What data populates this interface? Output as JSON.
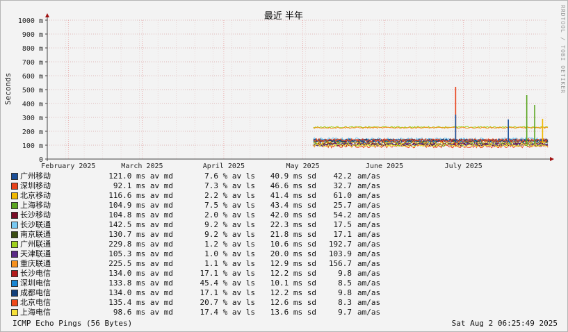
{
  "chart_data": {
    "type": "line",
    "title": "最近 半年",
    "ylabel": "Seconds",
    "ylim": [
      0,
      1000
    ],
    "y_ticks": [
      "0",
      "100 m",
      "200 m",
      "300 m",
      "400 m",
      "500 m",
      "600 m",
      "700 m",
      "800 m",
      "900 m",
      "1000 m"
    ],
    "x_ticks": [
      {
        "label": "February 2025",
        "date": "2025-02-01"
      },
      {
        "label": "March 2025",
        "date": "2025-03-01"
      },
      {
        "label": "April 2025",
        "date": "2025-04-01"
      },
      {
        "label": "May 2025",
        "date": "2025-05-01"
      },
      {
        "label": "June 2025",
        "date": "2025-06-01"
      },
      {
        "label": "July 2025",
        "date": "2025-07-01"
      }
    ],
    "x_range": [
      "2025-01-24",
      "2025-08-02"
    ],
    "grid": true,
    "data_start": "2025-05-05",
    "series": [
      {
        "name": "广州移动",
        "color": "#1a4f99",
        "avg": 121.0
      },
      {
        "name": "深圳移动",
        "color": "#e8421b",
        "avg": 92.1
      },
      {
        "name": "北京移动",
        "color": "#f0b800",
        "avg": 116.6
      },
      {
        "name": "上海移动",
        "color": "#5aa520",
        "avg": 104.9
      },
      {
        "name": "长沙移动",
        "color": "#7a0d27",
        "avg": 104.8
      },
      {
        "name": "长沙联通",
        "color": "#79c9f2",
        "avg": 142.5
      },
      {
        "name": "南京联通",
        "color": "#3a4d12",
        "avg": 130.7
      },
      {
        "name": "广州联通",
        "color": "#9ed11d",
        "avg": 229.8
      },
      {
        "name": "天津联通",
        "color": "#5a2a86",
        "avg": 105.3
      },
      {
        "name": "重庆联通",
        "color": "#f5901e",
        "avg": 225.5
      },
      {
        "name": "长沙电信",
        "color": "#b21a1a",
        "avg": 134.0
      },
      {
        "name": "深圳电信",
        "color": "#1a86d2",
        "avg": 133.8
      },
      {
        "name": "成都电信",
        "color": "#123f7a",
        "avg": 134.0
      },
      {
        "name": "北京电信",
        "color": "#f04a1a",
        "avg": 135.4
      },
      {
        "name": "上海电信",
        "color": "#f5e03a",
        "avg": 98.6
      }
    ],
    "spikes": [
      {
        "series": "深圳移动",
        "date": "2025-06-28",
        "value": 520
      },
      {
        "series": "广州移动",
        "date": "2025-06-28",
        "value": 320
      },
      {
        "series": "上海移动",
        "date": "2025-07-25",
        "value": 460
      },
      {
        "series": "上海移动",
        "date": "2025-07-28",
        "value": 390
      },
      {
        "series": "广州移动",
        "date": "2025-07-18",
        "value": 285
      },
      {
        "series": "北京移动",
        "date": "2025-07-31",
        "value": 290
      }
    ]
  },
  "watermark": "RRDTOOL / TOBI OETIKER",
  "legend": {
    "rows": [
      {
        "name": "广州移动",
        "avg": "121.0 ms av md",
        "loss": "7.6 % av ls",
        "sd": "40.9 ms sd",
        "amas": "42.2",
        "unit": "am/as"
      },
      {
        "name": "深圳移动",
        "avg": "92.1 ms av md",
        "loss": "7.3 % av ls",
        "sd": "46.6 ms sd",
        "amas": "32.7",
        "unit": "am/as"
      },
      {
        "name": "北京移动",
        "avg": "116.6 ms av md",
        "loss": "2.2 % av ls",
        "sd": "41.4 ms sd",
        "amas": "61.0",
        "unit": "am/as"
      },
      {
        "name": "上海移动",
        "avg": "104.9 ms av md",
        "loss": "7.5 % av ls",
        "sd": "43.4 ms sd",
        "amas": "25.7",
        "unit": "am/as"
      },
      {
        "name": "长沙移动",
        "avg": "104.8 ms av md",
        "loss": "2.0 % av ls",
        "sd": "42.0 ms sd",
        "amas": "54.2",
        "unit": "am/as"
      },
      {
        "name": "长沙联通",
        "avg": "142.5 ms av md",
        "loss": "9.2 % av ls",
        "sd": "22.3 ms sd",
        "amas": "17.5",
        "unit": "am/as"
      },
      {
        "name": "南京联通",
        "avg": "130.7 ms av md",
        "loss": "9.2 % av ls",
        "sd": "21.8 ms sd",
        "amas": "17.1",
        "unit": "am/as"
      },
      {
        "name": "广州联通",
        "avg": "229.8 ms av md",
        "loss": "1.2 % av ls",
        "sd": "10.6 ms sd",
        "amas": "192.7",
        "unit": "am/as"
      },
      {
        "name": "天津联通",
        "avg": "105.3 ms av md",
        "loss": "1.0 % av ls",
        "sd": "20.0 ms sd",
        "amas": "103.9",
        "unit": "am/as"
      },
      {
        "name": "重庆联通",
        "avg": "225.5 ms av md",
        "loss": "1.1 % av ls",
        "sd": "12.9 ms sd",
        "amas": "156.7",
        "unit": "am/as"
      },
      {
        "name": "长沙电信",
        "avg": "134.0 ms av md",
        "loss": "17.1 % av ls",
        "sd": "12.2 ms sd",
        "amas": "9.8",
        "unit": "am/as"
      },
      {
        "name": "深圳电信",
        "avg": "133.8 ms av md",
        "loss": "45.4 % av ls",
        "sd": "10.1 ms sd",
        "amas": "8.5",
        "unit": "am/as"
      },
      {
        "name": "成都电信",
        "avg": "134.0 ms av md",
        "loss": "17.1 % av ls",
        "sd": "12.2 ms sd",
        "amas": "9.8",
        "unit": "am/as"
      },
      {
        "name": "北京电信",
        "avg": "135.4 ms av md",
        "loss": "20.7 % av ls",
        "sd": "12.6 ms sd",
        "amas": "8.3",
        "unit": "am/as"
      },
      {
        "name": "上海电信",
        "avg": "98.6 ms av md",
        "loss": "17.4 % av ls",
        "sd": "13.6 ms sd",
        "amas": "9.7",
        "unit": "am/as"
      }
    ]
  },
  "footer": {
    "left": "ICMP Echo Pings (56 Bytes)",
    "right": "Sat Aug  2 06:25:49 2025"
  }
}
